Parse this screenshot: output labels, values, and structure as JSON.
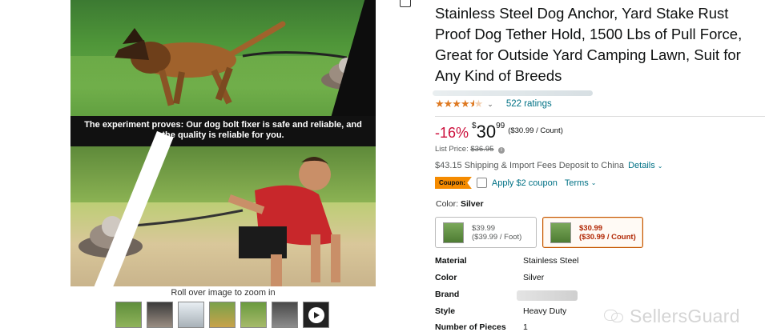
{
  "gallery": {
    "caption": "The experiment proves: Our dog bolt fixer is safe and reliable, and the quality is reliable for you.",
    "zoom_hint": "Roll over image to zoom in",
    "thumbnails": [
      "thumb-1",
      "thumb-2",
      "thumb-3",
      "thumb-4",
      "thumb-5",
      "thumb-6",
      "video-play"
    ]
  },
  "product": {
    "title_line1": "Stainless Steel Dog Anchor, Yard Stake Rust",
    "title_line2": "Proof Dog Tether Hold, 1500 Lbs of Pull Force,",
    "title_line3": "Great for Outside Yard Camping Lawn, Suit for",
    "title_line4": "Any Kind of Breeds",
    "rating_stars": "4.5",
    "ratings_count": "522 ratings"
  },
  "pricing": {
    "discount": "-16%",
    "currency": "$",
    "price_whole": "30",
    "price_fraction": "99",
    "per_count": "($30.99 / Count)",
    "list_price_label": "List Price:",
    "list_price": "$36.95",
    "shipping": "$43.15 Shipping & Import Fees Deposit to China",
    "details_link": "Details",
    "coupon_badge": "Coupon:",
    "coupon_text": "Apply $2 coupon",
    "terms_link": "Terms"
  },
  "variations": {
    "color_label": "Color:",
    "color_value": "Silver",
    "options": [
      {
        "price": "$39.99",
        "unit": "($39.99 / Foot)"
      },
      {
        "price": "$30.99",
        "unit": "($30.99 / Count)"
      }
    ],
    "selected_index": 1
  },
  "specs": [
    {
      "key": "Material",
      "value": "Stainless Steel"
    },
    {
      "key": "Color",
      "value": "Silver"
    },
    {
      "key": "Brand",
      "value": ""
    },
    {
      "key": "Style",
      "value": "Heavy Duty"
    },
    {
      "key": "Number of Pieces",
      "value": "1"
    }
  ],
  "watermark": "SellersGuard",
  "colors": {
    "link": "#007185",
    "discount": "#cc0c39",
    "star": "#de7921",
    "coupon": "#f58b00",
    "selected_border": "#c45500"
  }
}
